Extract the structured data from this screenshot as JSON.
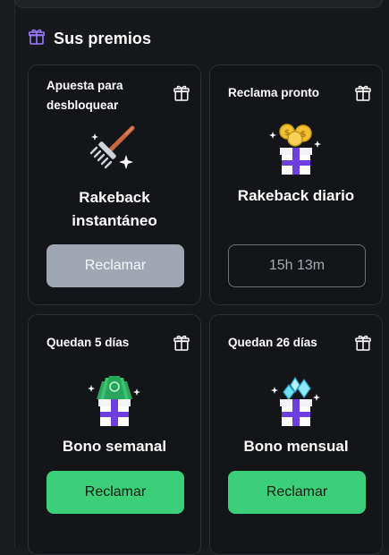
{
  "section": {
    "title": "Sus premios",
    "icon": "gift-icon",
    "accent": "#9b7bff"
  },
  "colors": {
    "primary": "#3ccf7a",
    "disabled": "#a0a7b2",
    "card_bg": "#141518"
  },
  "cards": [
    {
      "label": "Apuesta para\ndesbloquear",
      "title": "Rakeback\ninstantáneo",
      "button": "Reclamar",
      "state": "disabled",
      "illustration": "rake-icon"
    },
    {
      "label": "Reclama pronto",
      "title": "Rakeback diario",
      "button": "15h 13m",
      "state": "timer",
      "illustration": "gift-box-coins-icon"
    },
    {
      "label": "Quedan 5 días",
      "title": "Bono semanal",
      "button": "Reclamar",
      "state": "primary",
      "illustration": "gift-box-cash-icon"
    },
    {
      "label": "Quedan 26 días",
      "title": "Bono mensual",
      "button": "Reclamar",
      "state": "primary",
      "illustration": "gift-box-diamonds-icon"
    }
  ]
}
